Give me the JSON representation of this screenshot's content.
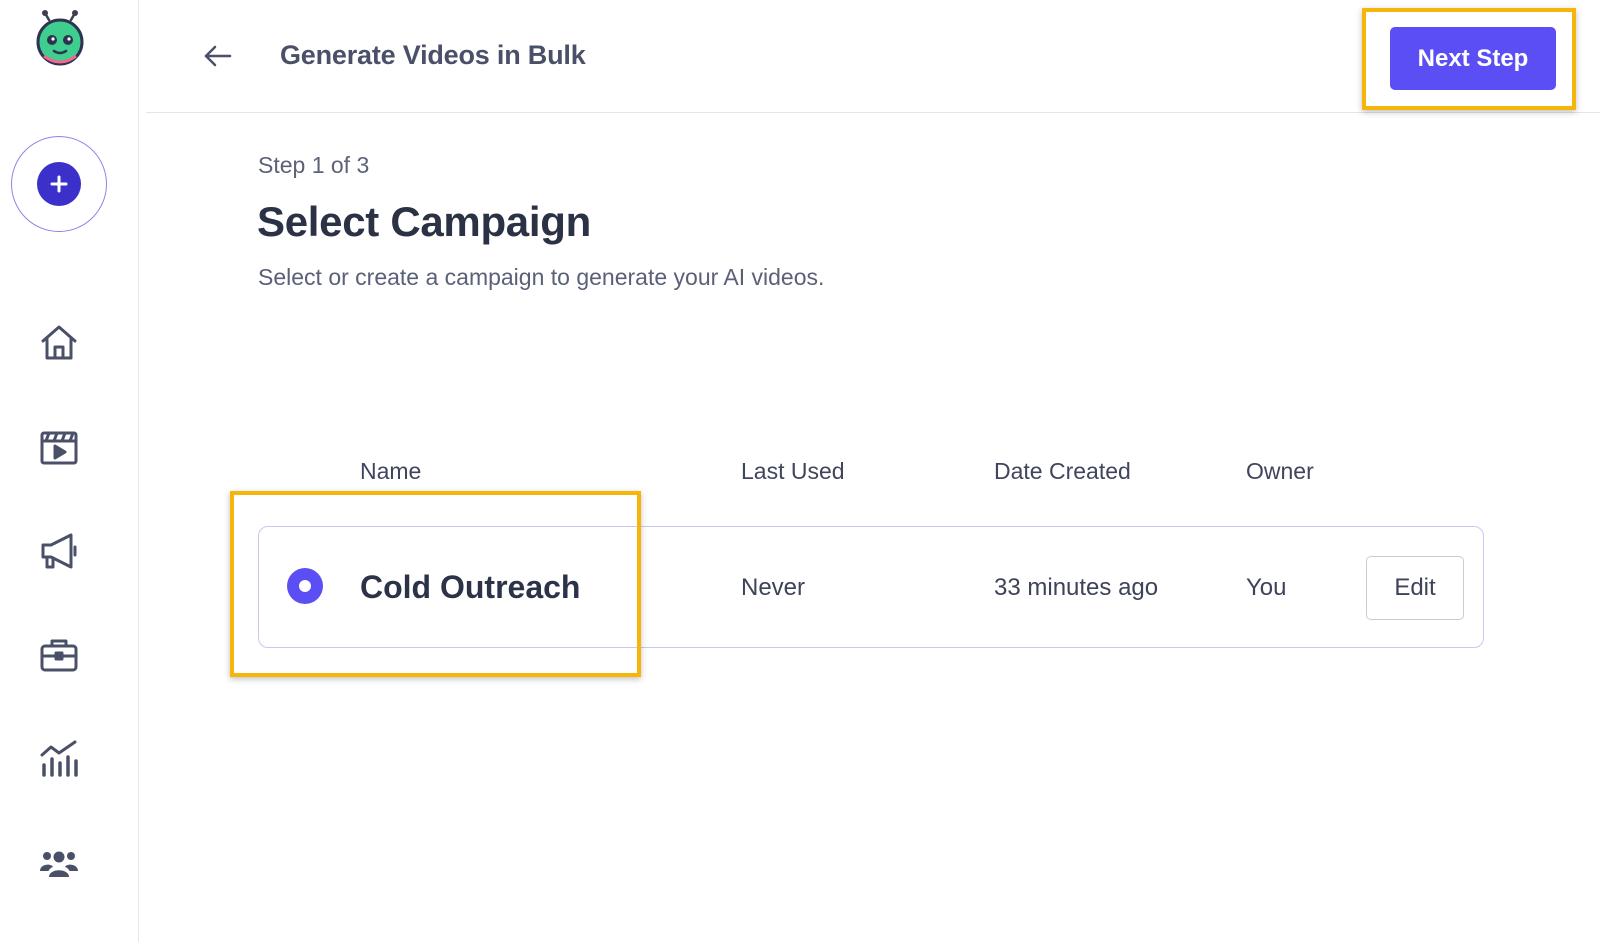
{
  "header": {
    "title": "Generate Videos in Bulk",
    "next_label": "Next Step"
  },
  "sidebar": {
    "items": [
      {
        "icon": "home-icon"
      },
      {
        "icon": "video-icon"
      },
      {
        "icon": "megaphone-icon"
      },
      {
        "icon": "briefcase-icon"
      },
      {
        "icon": "analytics-icon"
      },
      {
        "icon": "team-icon"
      }
    ]
  },
  "main": {
    "step": "Step 1 of 3",
    "title": "Select Campaign",
    "subtitle": "Select or create a campaign to generate your AI videos."
  },
  "table": {
    "columns": [
      "Name",
      "Last Used",
      "Date Created",
      "Owner"
    ],
    "rows": [
      {
        "name": "Cold Outreach",
        "last_used": "Never",
        "date_created": "33 minutes ago",
        "owner": "You",
        "edit_label": "Edit",
        "selected": true
      }
    ]
  },
  "colors": {
    "accent": "#5b4ef5",
    "highlight": "#f5b50a",
    "create_button": "#3b30c9",
    "logo_green": "#3ecf8e"
  }
}
